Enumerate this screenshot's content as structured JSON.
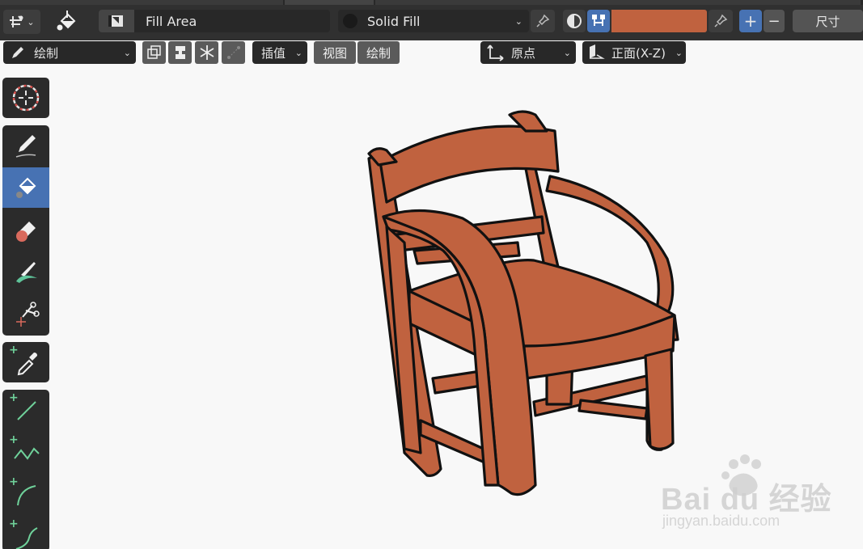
{
  "header": {
    "fill_mode_label": "Fill Area",
    "fill_style_label": "Solid Fill",
    "color_swatch": "#c0623f",
    "size_label": "尺寸",
    "plus_label": "+",
    "minus_label": "−"
  },
  "tool_header": {
    "mode_label": "绘制",
    "interp_label": "插值",
    "view_label": "视图",
    "draw_label": "绘制",
    "origin_label": "原点",
    "plane_label": "正面(X-Z)"
  },
  "toolbar": {
    "tools": [
      {
        "name": "cursor-tool",
        "icon": "cursor-icon",
        "active": false
      },
      {
        "name": "draw-tool",
        "icon": "pencil-icon",
        "active": false
      },
      {
        "name": "fill-tool",
        "icon": "bucket-icon",
        "active": true
      },
      {
        "name": "erase-tool",
        "icon": "eraser-icon",
        "active": false
      },
      {
        "name": "tint-tool",
        "icon": "brush-icon",
        "active": false
      },
      {
        "name": "cutter-tool",
        "icon": "scissors-icon",
        "active": false
      },
      {
        "name": "eyedropper-tool",
        "icon": "eyedropper-icon",
        "active": false
      },
      {
        "name": "line-tool",
        "icon": "line-icon",
        "active": false
      },
      {
        "name": "polyline-tool",
        "icon": "polyline-icon",
        "active": false
      },
      {
        "name": "arc-tool",
        "icon": "arc-icon",
        "active": false
      },
      {
        "name": "curve-tool",
        "icon": "curve-icon",
        "active": false
      }
    ]
  },
  "canvas": {
    "chair_color": "#c0623f",
    "outline_color": "#111111"
  },
  "watermark": {
    "brand": "Bai du 经验",
    "url": "jingyan.baidu.com"
  },
  "colors": {
    "accent": "#4772b3",
    "header_bg": "#303030"
  }
}
